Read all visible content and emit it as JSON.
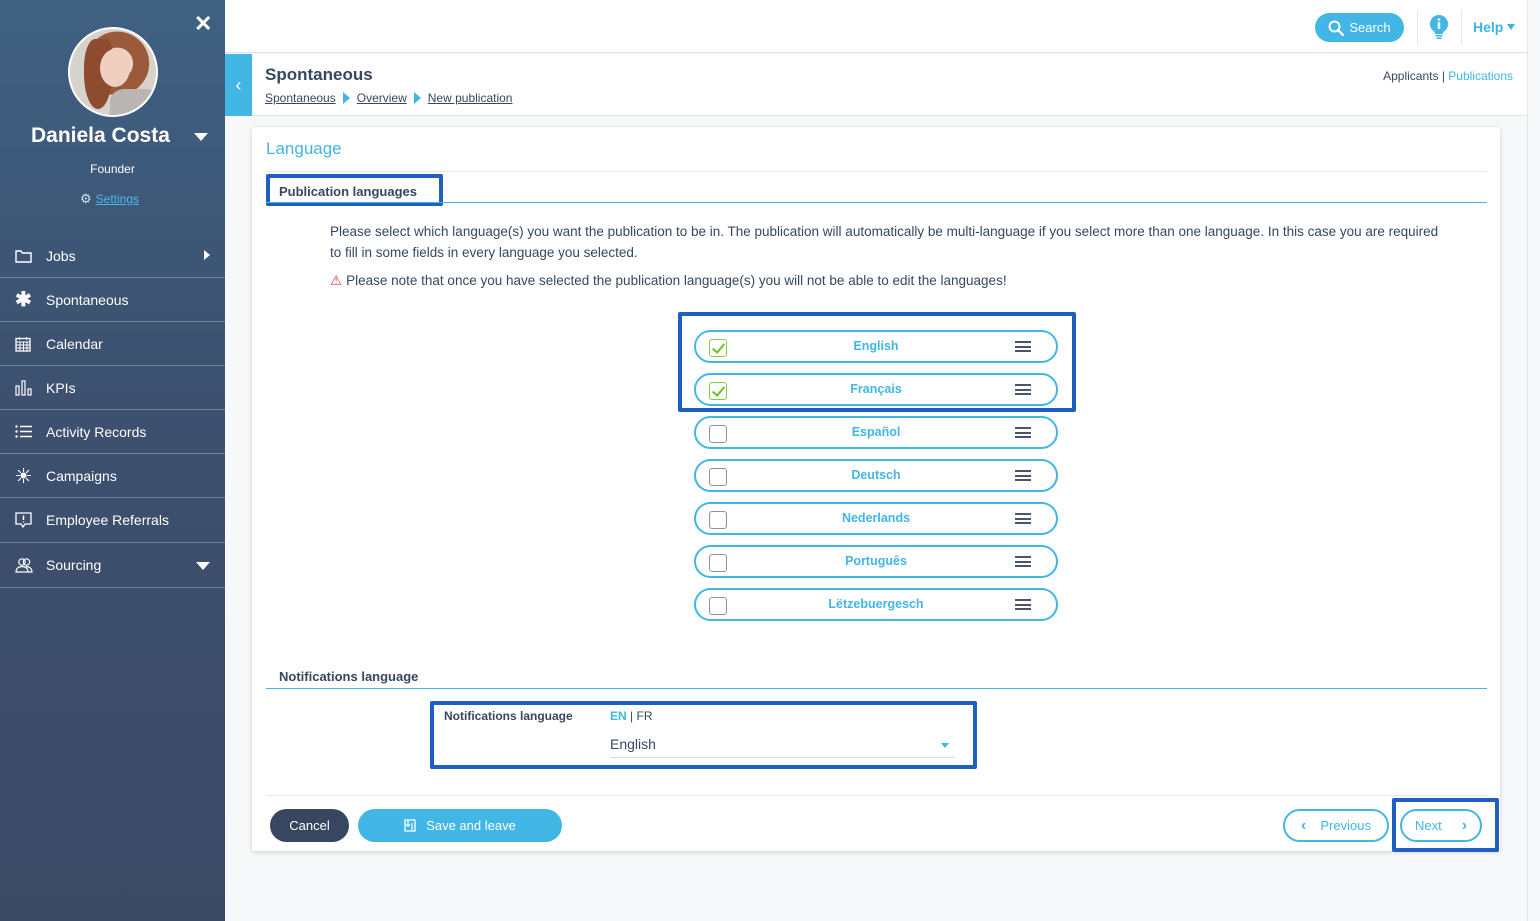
{
  "sidebar": {
    "user": {
      "name": "Daniela Costa",
      "role": "Founder",
      "settings_label": "Settings"
    },
    "items": [
      {
        "label": "Jobs",
        "icon": "folder-icon",
        "indicator": "arrow-right"
      },
      {
        "label": "Spontaneous",
        "icon": "asterisk-icon"
      },
      {
        "label": "Calendar",
        "icon": "calendar-icon"
      },
      {
        "label": "KPIs",
        "icon": "bar-chart-icon"
      },
      {
        "label": "Activity Records",
        "icon": "list-icon"
      },
      {
        "label": "Campaigns",
        "icon": "network-icon"
      },
      {
        "label": "Employee Referrals",
        "icon": "referral-icon"
      },
      {
        "label": "Sourcing",
        "icon": "users-icon",
        "indicator": "arrow-down"
      }
    ]
  },
  "topbar": {
    "search_label": "Search",
    "help_label": "Help"
  },
  "header": {
    "title": "Spontaneous",
    "breadcrumb": [
      "Spontaneous",
      "Overview",
      "New publication"
    ],
    "links": {
      "applicants": "Applicants",
      "separator": "|",
      "publications": "Publications"
    }
  },
  "card": {
    "title": "Language",
    "publication_languages": {
      "heading": "Publication languages",
      "description": "Please select which language(s) you want the publication to be in. The publication will automatically be multi-language if you select more than one language. In this case you are required to fill in some fields in every language you selected.",
      "warning": "Please note that once you have selected the publication language(s) you will not be able to edit the languages!",
      "languages": [
        {
          "name": "English",
          "checked": true
        },
        {
          "name": "Français",
          "checked": true
        },
        {
          "name": "Español",
          "checked": false
        },
        {
          "name": "Deutsch",
          "checked": false
        },
        {
          "name": "Nederlands",
          "checked": false
        },
        {
          "name": "Português",
          "checked": false
        },
        {
          "name": "Lëtzebuergesch",
          "checked": false
        }
      ]
    },
    "notifications": {
      "heading": "Notifications language",
      "field_label": "Notifications language",
      "lang_en": "EN",
      "lang_sep": "|",
      "lang_fr": "FR",
      "selected_value": "English"
    },
    "buttons": {
      "cancel": "Cancel",
      "save_and_leave": "Save and leave",
      "previous": "Previous",
      "next": "Next"
    }
  },
  "colors": {
    "accent": "#42b6e5",
    "dark": "#374760",
    "highlight": "#1f5fbf",
    "check": "#6cc02c",
    "warning": "#e0393e"
  }
}
